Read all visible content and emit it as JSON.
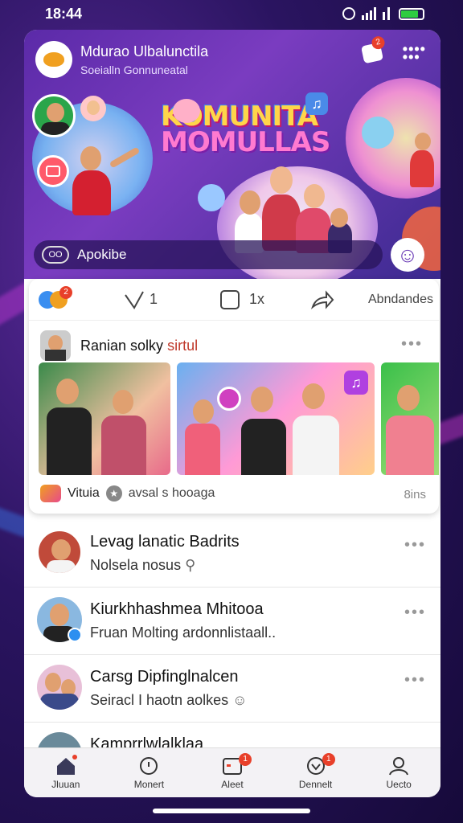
{
  "status_bar": {
    "time": "18:44"
  },
  "banner": {
    "community_name": "Mdurao Ulbalunctila",
    "community_sub": "Soeialln Gonnuneatal",
    "hero_line1": "KOMUNITA",
    "hero_line2": "MOMULLAS",
    "notification_count": "2",
    "composer_pill": "OO",
    "composer_text": "Apokibe"
  },
  "actions": {
    "reactions_badge": "2",
    "like_count": "1",
    "comment_label": "1x",
    "more_label": "Abndandes"
  },
  "post": {
    "author": "Ranian solky",
    "author_tag": "sirtul",
    "footer_name": "Vituia",
    "footer_text": "avsal s hooaga",
    "footer_right": "8ins"
  },
  "list": [
    {
      "name": "Levag lanatic Badrits",
      "sub": "Nolsela nosus"
    },
    {
      "name": "Kiurkhhashmea Mhitooa",
      "sub": "Fruan Molting ardonnlistaall.."
    },
    {
      "name": "Carsg Dipfinglnalcen",
      "sub": "Seiracl I haotn aolkes"
    },
    {
      "name": "Kamprrlwlalklaa",
      "sub": ""
    }
  ],
  "tabs": [
    {
      "label": "Jluuan",
      "icon": "home-icon"
    },
    {
      "label": "Monert",
      "icon": "bell-icon"
    },
    {
      "label": "Aleet",
      "icon": "calendar-icon",
      "badge": "1"
    },
    {
      "label": "Dennelt",
      "icon": "heart-icon",
      "badge": "1"
    },
    {
      "label": "Uecto",
      "icon": "user-icon"
    }
  ],
  "colors": {
    "banner_start": "#5b2aa8",
    "accent_badge": "#e8402a",
    "online_blue": "#2d8ff0"
  }
}
